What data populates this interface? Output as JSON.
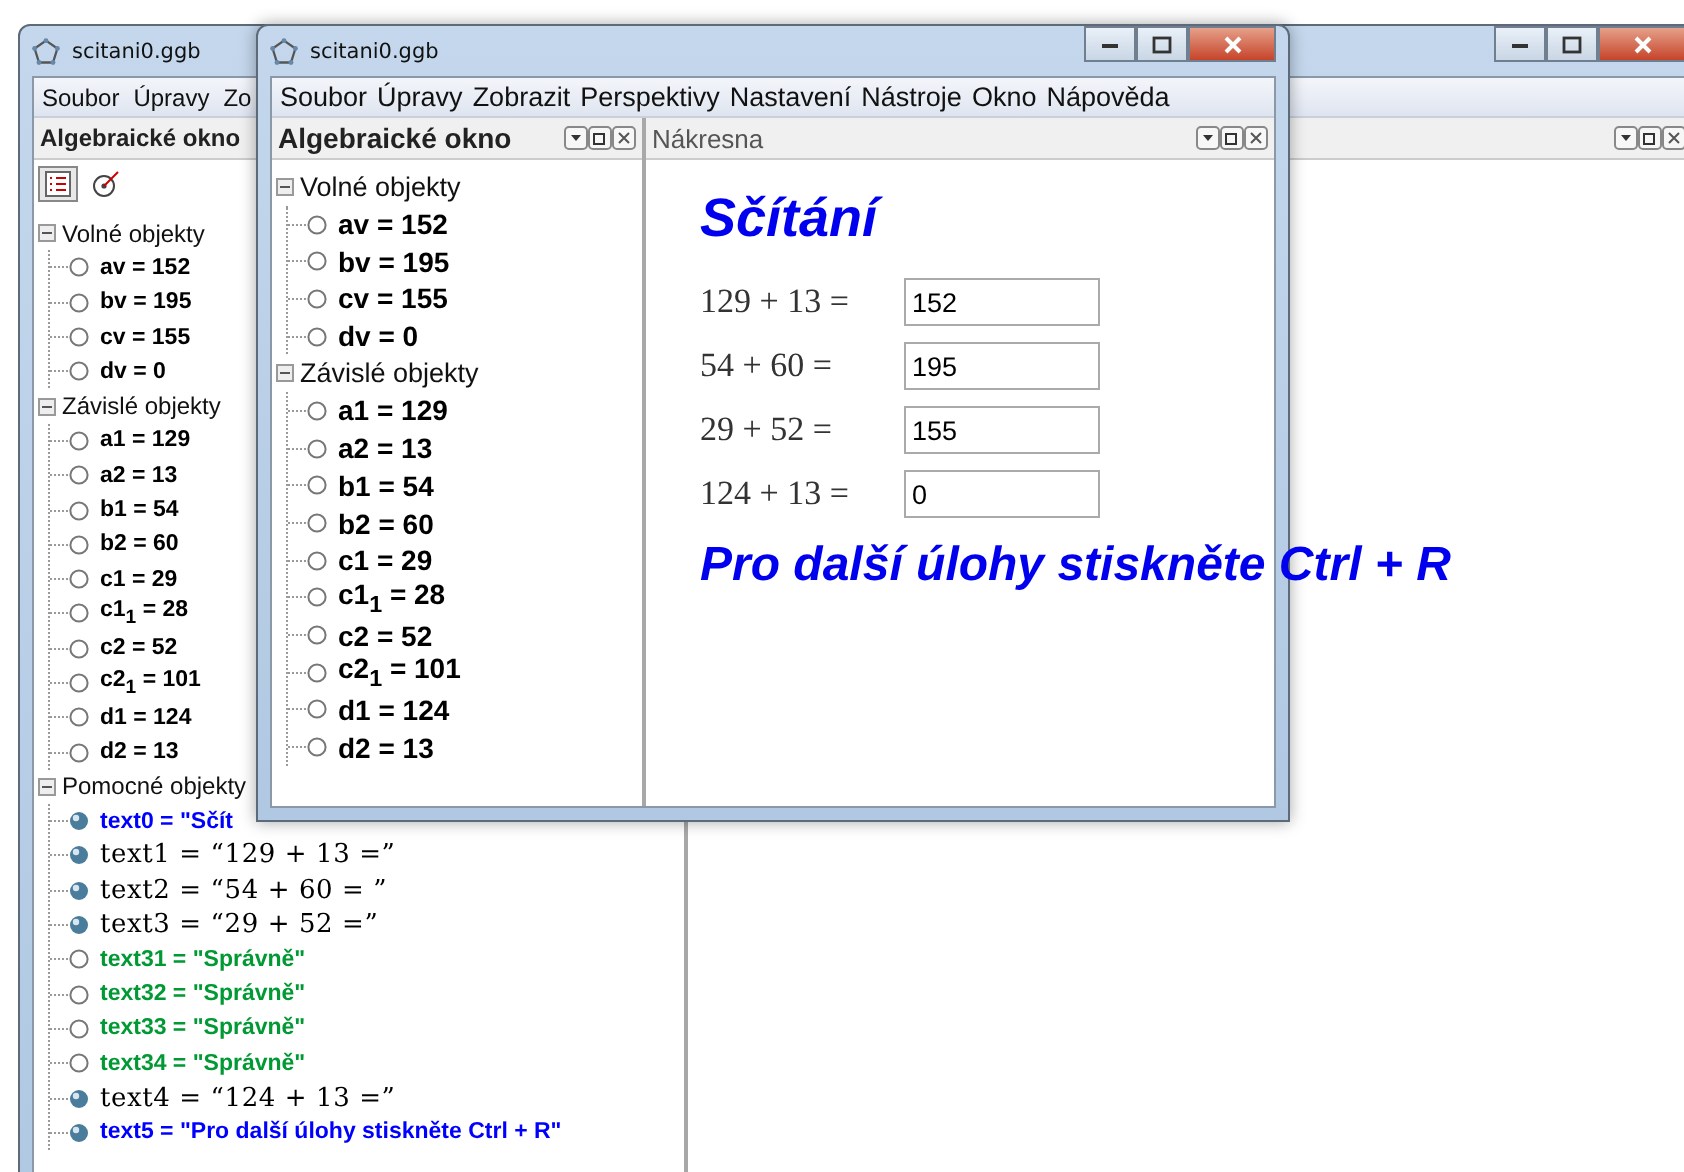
{
  "back_window": {
    "title": "scitani0.ggb",
    "menu": [
      "Soubor",
      "Úpravy",
      "Zo"
    ],
    "algebra_panel": {
      "title": "Algebraické okno",
      "groups": [
        {
          "label": "Volné objekty",
          "expanded": true,
          "children": [
            {
              "label": "av = 152",
              "visible": false,
              "color": "#000000",
              "kind": "plain"
            },
            {
              "label": "bv = 195",
              "visible": false,
              "color": "#000000",
              "kind": "plain"
            },
            {
              "label": "cv = 155",
              "visible": false,
              "color": "#000000",
              "kind": "plain"
            },
            {
              "label": "dv = 0",
              "visible": false,
              "color": "#000000",
              "kind": "plain"
            }
          ]
        },
        {
          "label": "Závislé objekty",
          "expanded": true,
          "children": [
            {
              "label": "a1 = 129",
              "visible": false,
              "color": "#000000",
              "kind": "plain"
            },
            {
              "label": "a2 = 13",
              "visible": false,
              "color": "#000000",
              "kind": "plain"
            },
            {
              "label": "b1 = 54",
              "visible": false,
              "color": "#000000",
              "kind": "plain"
            },
            {
              "label": "b2 = 60",
              "visible": false,
              "color": "#000000",
              "kind": "plain"
            },
            {
              "label": "c1 = 29",
              "visible": false,
              "color": "#000000",
              "kind": "plain"
            },
            {
              "label": "c1$_{1}$ = 28",
              "visible": false,
              "color": "#000000",
              "kind": "plain"
            },
            {
              "label": "c2 = 52",
              "visible": false,
              "color": "#000000",
              "kind": "plain"
            },
            {
              "label": "c2$_{1}$ = 101",
              "visible": false,
              "color": "#000000",
              "kind": "plain"
            },
            {
              "label": "d1 = 124",
              "visible": false,
              "color": "#000000",
              "kind": "plain"
            },
            {
              "label": "d2 = 13",
              "visible": false,
              "color": "#000000",
              "kind": "plain"
            }
          ]
        },
        {
          "label": "Pomocné objekty",
          "expanded": true,
          "children": [
            {
              "label": "text0 = \"Sčít",
              "visible": true,
              "color": "#0000ff",
              "kind": "plain"
            },
            {
              "label": "text1 = “129 + 13 =”",
              "visible": true,
              "color": "#000000",
              "kind": "latex"
            },
            {
              "label": "text2 = “54 + 60  = ”",
              "visible": true,
              "color": "#000000",
              "kind": "latex"
            },
            {
              "label": "text3 = “29 + 52 =”",
              "visible": true,
              "color": "#000000",
              "kind": "latex"
            },
            {
              "label": "text31 = \"Správně\"",
              "visible": false,
              "color": "#009933",
              "kind": "plain"
            },
            {
              "label": "text32 = \"Správně\"",
              "visible": false,
              "color": "#009933",
              "kind": "plain"
            },
            {
              "label": "text33 = \"Správně\"",
              "visible": false,
              "color": "#009933",
              "kind": "plain"
            },
            {
              "label": "text34 = \"Správně\"",
              "visible": false,
              "color": "#009933",
              "kind": "plain"
            },
            {
              "label": "text4 = “124 + 13 =”",
              "visible": true,
              "color": "#000000",
              "kind": "latex"
            },
            {
              "label": "text5 = \"Pro další úlohy stiskněte Ctrl + R\"",
              "visible": true,
              "color": "#0000ff",
              "kind": "plain"
            }
          ]
        }
      ]
    }
  },
  "front_window": {
    "title": "scitani0.ggb",
    "menu": [
      "Soubor",
      "Úpravy",
      "Zobrazit",
      "Perspektivy",
      "Nastavení",
      "Nástroje",
      "Okno",
      "Nápověda"
    ],
    "algebra_panel": {
      "title": "Algebraické okno",
      "groups": [
        {
          "label": "Volné objekty",
          "expanded": true,
          "children": [
            {
              "label": "av = 152",
              "visible": false,
              "color": "#000000",
              "kind": "plain"
            },
            {
              "label": "bv = 195",
              "visible": false,
              "color": "#000000",
              "kind": "plain"
            },
            {
              "label": "cv = 155",
              "visible": false,
              "color": "#000000",
              "kind": "plain"
            },
            {
              "label": "dv = 0",
              "visible": false,
              "color": "#000000",
              "kind": "plain"
            }
          ]
        },
        {
          "label": "Závislé objekty",
          "expanded": true,
          "children": [
            {
              "label": "a1 = 129",
              "visible": false,
              "color": "#000000",
              "kind": "plain"
            },
            {
              "label": "a2 = 13",
              "visible": false,
              "color": "#000000",
              "kind": "plain"
            },
            {
              "label": "b1 = 54",
              "visible": false,
              "color": "#000000",
              "kind": "plain"
            },
            {
              "label": "b2 = 60",
              "visible": false,
              "color": "#000000",
              "kind": "plain"
            },
            {
              "label": "c1 = 29",
              "visible": false,
              "color": "#000000",
              "kind": "plain"
            },
            {
              "label": "c1$_{1}$ = 28",
              "visible": false,
              "color": "#000000",
              "kind": "plain"
            },
            {
              "label": "c2 = 52",
              "visible": false,
              "color": "#000000",
              "kind": "plain"
            },
            {
              "label": "c2$_{1}$ = 101",
              "visible": false,
              "color": "#000000",
              "kind": "plain"
            },
            {
              "label": "d1 = 124",
              "visible": false,
              "color": "#000000",
              "kind": "plain"
            },
            {
              "label": "d2 = 13",
              "visible": false,
              "color": "#000000",
              "kind": "plain"
            }
          ]
        }
      ]
    },
    "graphics_panel": {
      "title": "Nákresna",
      "heading": "Sčítání",
      "exercises": [
        {
          "equation": "129 + 13 =",
          "value": "152"
        },
        {
          "equation": "54 + 60 =",
          "value": "195"
        },
        {
          "equation": "29 + 52 =",
          "value": "155"
        },
        {
          "equation": "124 + 13 =",
          "value": "0"
        }
      ],
      "hint": "Pro další úlohy stiskněte Ctrl + R"
    }
  }
}
